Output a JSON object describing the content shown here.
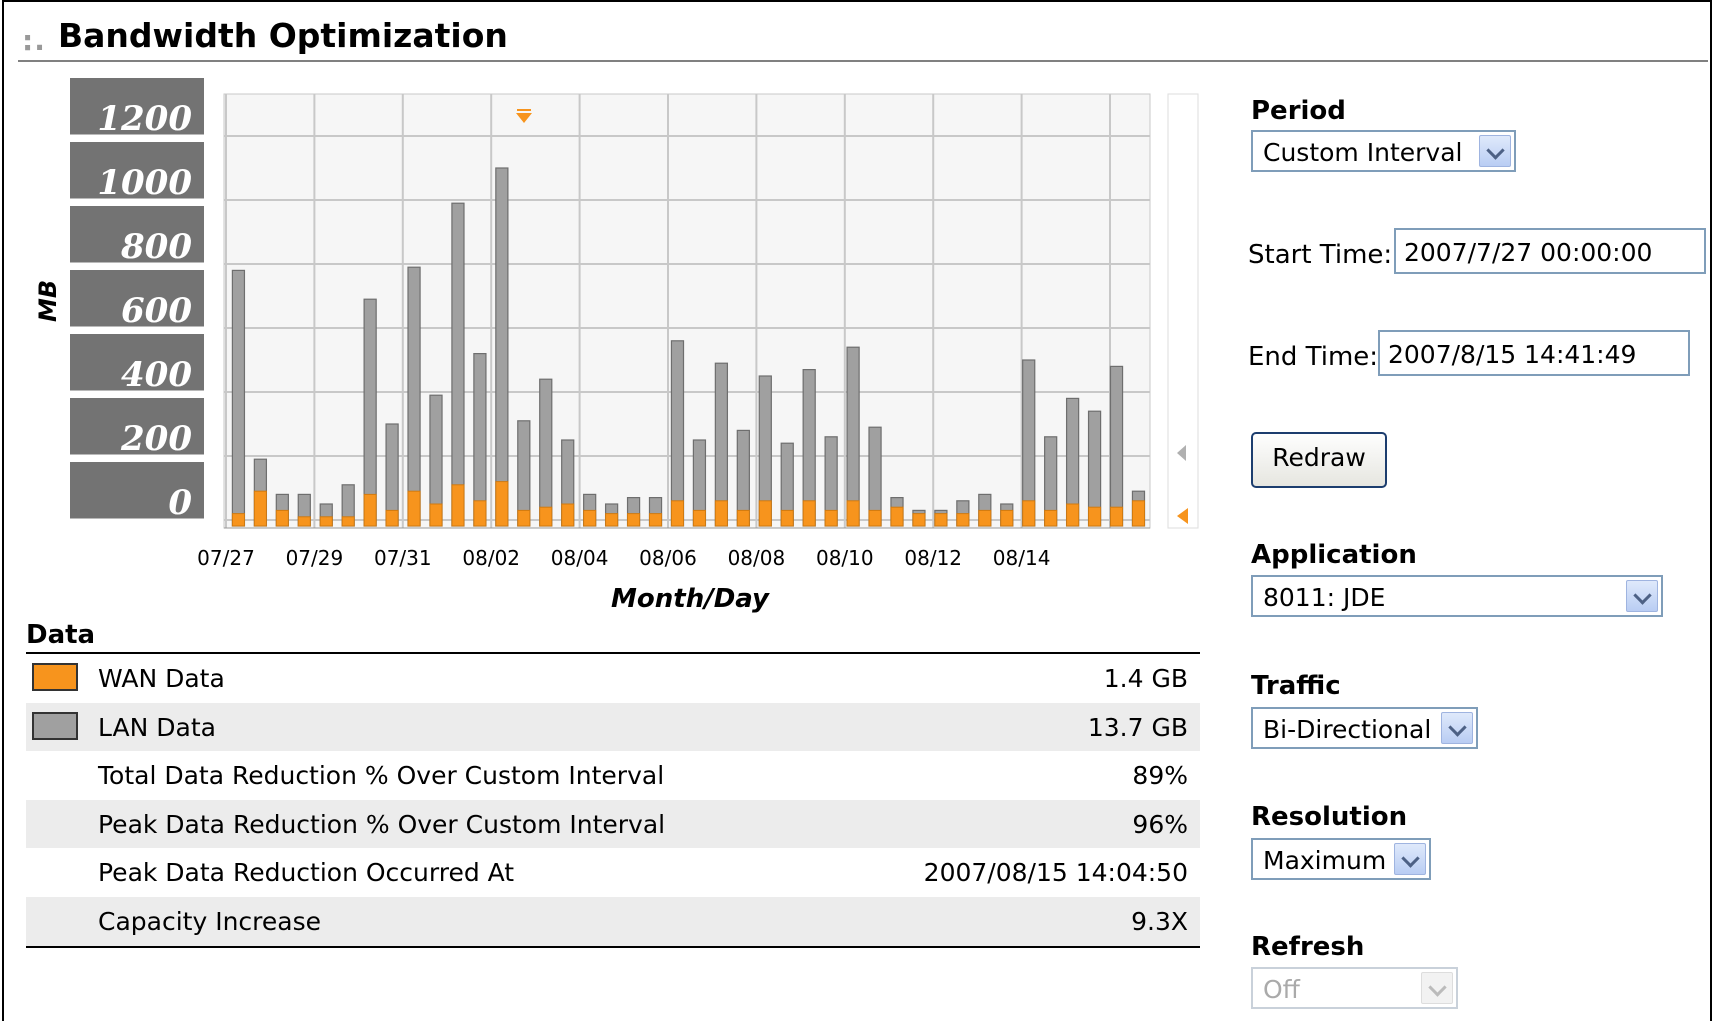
{
  "header": {
    "title": "Bandwidth Optimization"
  },
  "chart_data": {
    "type": "bar",
    "xlabel": "Month/Day",
    "ylabel": "MB",
    "ylim": [
      0,
      1200
    ],
    "yticks": [
      "1200",
      "1000",
      "800",
      "600",
      "400",
      "200",
      "0"
    ],
    "xticks": [
      "07/27",
      "07/29",
      "07/31",
      "08/02",
      "08/04",
      "08/06",
      "08/08",
      "08/10",
      "08/12",
      "08/14"
    ],
    "grid": true,
    "series": [
      {
        "name": "LAN Data",
        "color": "#a0a0a0",
        "values": [
          780,
          190,
          80,
          80,
          50,
          110,
          690,
          300,
          790,
          390,
          990,
          520,
          1100,
          310,
          440,
          250,
          80,
          50,
          70,
          70,
          560,
          250,
          490,
          280,
          450,
          240,
          470,
          260,
          540,
          290,
          70,
          30,
          30,
          60,
          80,
          50,
          500,
          260,
          380,
          340,
          480,
          90
        ]
      },
      {
        "name": "WAN Data",
        "color": "#f7941d",
        "values": [
          20,
          90,
          30,
          10,
          10,
          10,
          80,
          30,
          90,
          50,
          110,
          60,
          120,
          30,
          40,
          50,
          30,
          20,
          20,
          20,
          60,
          30,
          60,
          30,
          60,
          30,
          60,
          30,
          60,
          30,
          40,
          20,
          20,
          20,
          30,
          30,
          60,
          30,
          50,
          40,
          40,
          60
        ]
      }
    ]
  },
  "data_section": {
    "heading": "Data",
    "rows": [
      {
        "label": "WAN Data",
        "value": "1.4 GB",
        "swatch": "#f7941d"
      },
      {
        "label": "LAN Data",
        "value": "13.7 GB",
        "swatch": "#a0a0a0"
      },
      {
        "label": "Total Data Reduction % Over Custom Interval",
        "value": "89%"
      },
      {
        "label": "Peak Data Reduction % Over Custom Interval",
        "value": "96%"
      },
      {
        "label": "Peak Data Reduction Occurred At",
        "value": "2007/08/15 14:04:50"
      },
      {
        "label": "Capacity Increase",
        "value": "9.3X"
      }
    ]
  },
  "controls": {
    "period": {
      "label": "Period",
      "value": "Custom Interval"
    },
    "start_time": {
      "label": "Start Time:",
      "value": "2007/7/27 00:00:00"
    },
    "end_time": {
      "label": "End Time:",
      "value": "2007/8/15 14:41:49"
    },
    "redraw": {
      "label": "Redraw"
    },
    "application": {
      "label": "Application",
      "value": "8011: JDE"
    },
    "traffic": {
      "label": "Traffic",
      "value": "Bi-Directional"
    },
    "resolution": {
      "label": "Resolution",
      "value": "Maximum"
    },
    "refresh": {
      "label": "Refresh",
      "value": "Off"
    }
  }
}
